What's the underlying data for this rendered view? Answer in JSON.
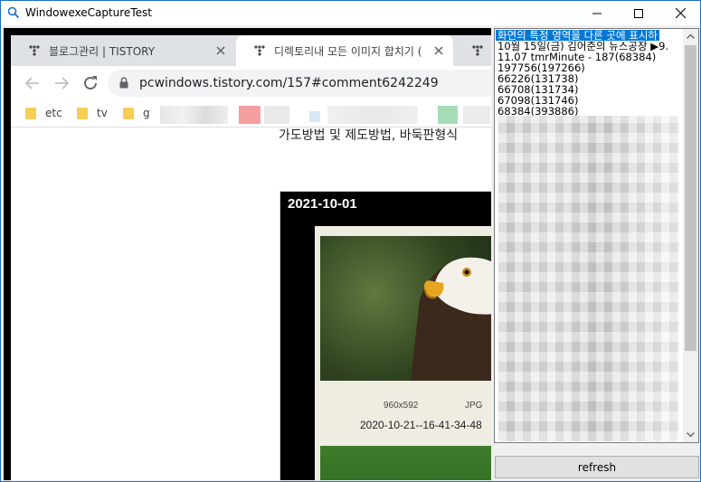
{
  "window": {
    "title": "WindowexeCaptureTest"
  },
  "browser": {
    "tabs": [
      {
        "label": "블로그관리 | TISTORY",
        "active": false
      },
      {
        "label": "디렉토리내 모든 이미지 합치기 (",
        "active": true
      },
      {
        "label": "",
        "active": false
      }
    ],
    "url": "pcwindows.tistory.com/157#comment6242249",
    "bookmarks": [
      "etc",
      "tv",
      "g"
    ],
    "partial_text": "가도방법 및 제도방법, 바둑판형식",
    "post": {
      "date": "2021-10-01",
      "image_size": "960x592",
      "image_type": "JPG",
      "filename": "2020-10-21--16-41-34-48"
    }
  },
  "listbox": {
    "items": [
      "화면의 특정 영역을 다른 곳에 표시하",
      "10월 15일(금) 김어준의 뉴스공장 ▶9.",
      "11.07 tmrMinute - 187(68384)",
      "197756(197266)",
      "66226(131738)",
      "66708(131734)",
      "67098(131746)",
      "68384(393886)"
    ],
    "selected_index": 0
  },
  "buttons": {
    "refresh": "refresh"
  },
  "colors": {
    "accent": "#0078d7",
    "tab_strip": "#dee1e6",
    "folder": "#f7cd56"
  }
}
